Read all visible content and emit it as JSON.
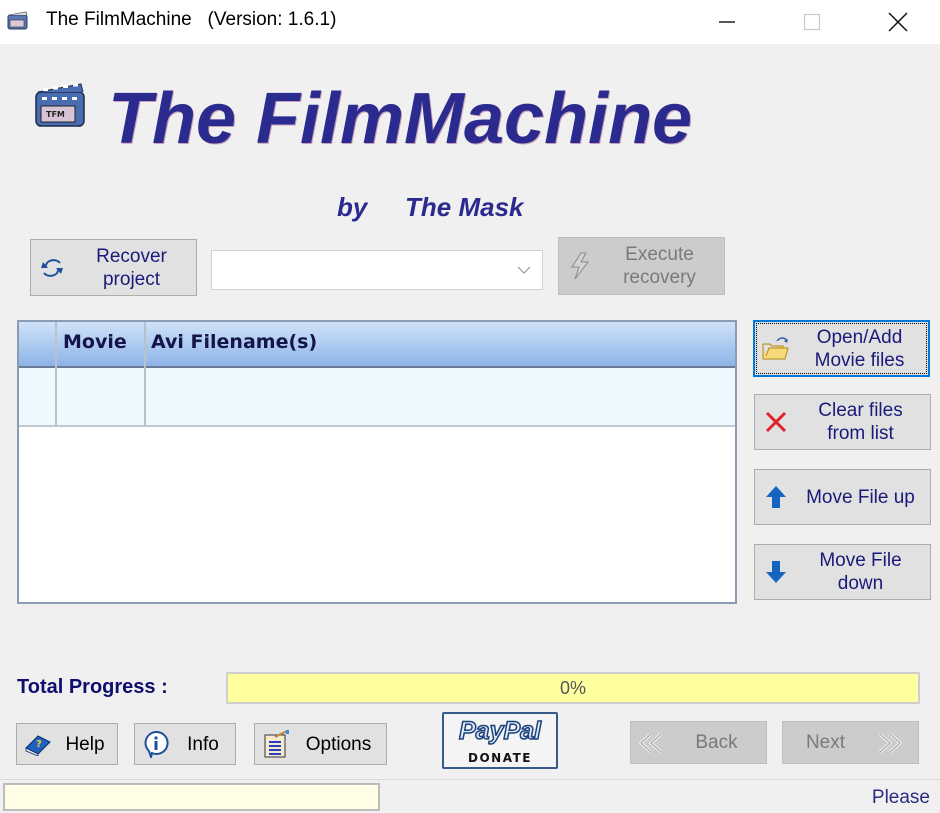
{
  "window": {
    "title": "The FilmMachine   (Version: 1.6.1)",
    "controls": {
      "minimize": "minimize-icon",
      "maximize": "maximize-icon",
      "close": "close-icon"
    }
  },
  "banner": {
    "title": "The FilmMachine",
    "by": "by",
    "author": "The Mask",
    "logo_icon": "film-clapper-icon"
  },
  "recovery": {
    "recover_label_line1": "Recover",
    "recover_label_line2": "project",
    "recover_icon": "recover-arrows-icon",
    "project_select_value": "",
    "execute_label_line1": "Execute",
    "execute_label_line2": "recovery",
    "execute_icon": "lightning-icon",
    "execute_disabled": true
  },
  "grid": {
    "columns": [
      "",
      "Movie",
      "Avi Filename(s)"
    ],
    "rows": [
      [
        "",
        "",
        ""
      ]
    ]
  },
  "side_buttons": {
    "open_line1": "Open/Add",
    "open_line2": "Movie files",
    "clear_line1": "Clear files",
    "clear_line2": "from list",
    "up_label": "Move File up",
    "down_line1": "Move File",
    "down_line2": "down"
  },
  "progress": {
    "label": "Total Progress :",
    "value_percent": 0,
    "text": "0%"
  },
  "bottom": {
    "help": "Help",
    "info": "Info",
    "options": "Options",
    "paypal_logo": "PayPal",
    "paypal_donate": "DONATE",
    "back": "Back",
    "next": "Next",
    "back_disabled": true,
    "next_disabled": true
  },
  "status": {
    "field_value": "",
    "text": "Please"
  },
  "colors": {
    "brand_text": "#2b2b8f",
    "progress_track": "#ffffa0",
    "grid_header_top": "#cfe2f8",
    "grid_header_bottom": "#8db4e8",
    "focus_border": "#0078d7"
  }
}
